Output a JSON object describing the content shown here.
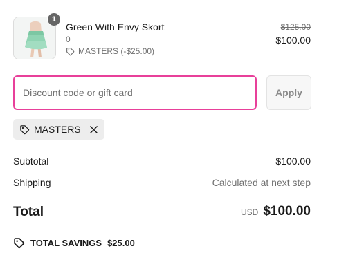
{
  "line_item": {
    "quantity": "1",
    "name": "Green With Envy Skort",
    "variant": "0",
    "discount_note": "MASTERS (-$25.00)",
    "price_original": "$125.00",
    "price_final": "$100.00",
    "icon": "tag-icon"
  },
  "discount": {
    "placeholder": "Discount code or gift card",
    "value": "",
    "apply_label": "Apply",
    "focus_color": "#e8409a"
  },
  "applied_code": {
    "code": "MASTERS",
    "icon": "tag-icon",
    "remove_icon": "close-icon"
  },
  "summary": {
    "subtotal_label": "Subtotal",
    "subtotal_value": "$100.00",
    "shipping_label": "Shipping",
    "shipping_value": "Calculated at next step",
    "total_label": "Total",
    "total_currency": "USD",
    "total_value": "$100.00"
  },
  "savings": {
    "label": "TOTAL SAVINGS",
    "value": "$25.00",
    "icon": "tag-icon"
  }
}
